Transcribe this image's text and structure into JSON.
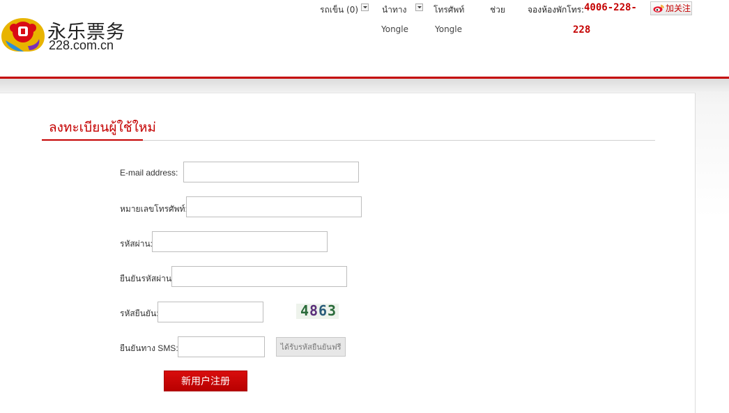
{
  "header": {
    "logo_cn": "永乐票务",
    "logo_domain": "228.com.cn",
    "nav": {
      "cart": "รถเข็น (0)",
      "navigation": "นำทาง",
      "navigation_sub": "Yongle",
      "phone_menu": "โทรศัพท์",
      "phone_menu_sub": "Yongle",
      "help": "ช่วย"
    },
    "booking_label": "จองห้องพักโทร:",
    "booking_number_line1": "4006-228-",
    "booking_number_line2": "228",
    "follow_label": "加关注"
  },
  "form": {
    "title": "ลงทะเบียนผู้ใช้ใหม่",
    "fields": {
      "email_label": "E-mail address:",
      "phone_label": "หมายเลขโทรศัพท์:",
      "password_label": "รหัสผ่าน:",
      "confirm_password_label": "ยืนยันรหัสผ่าน:",
      "captcha_label": "รหัสยืนยัน:",
      "sms_label": "ยืนยันทาง SMS:"
    },
    "values": {
      "email": "",
      "phone": "",
      "password": "",
      "confirm_password": "",
      "captcha": "",
      "sms": ""
    },
    "captcha_image_text": "4863",
    "sms_button": "ได้รับรหัสยืนยันฟรี",
    "submit_button": "新用户注册"
  },
  "colors": {
    "brand_red": "#c40000",
    "button_red": "#d80d0d",
    "border_grey": "#bdbdbd"
  }
}
